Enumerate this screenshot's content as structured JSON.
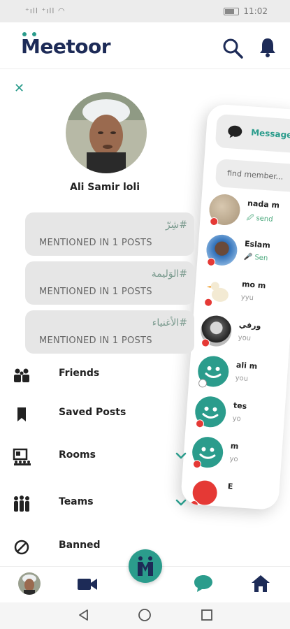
{
  "statusbar": {
    "signal": "⁺ıll ⁺ıll ◠",
    "time": "11:02"
  },
  "app": {
    "logo_text": "eetoor",
    "logo_m": "M"
  },
  "drawer": {
    "close_icon": "close-icon",
    "profile_name": "Ali Samir loli",
    "tags": [
      {
        "name": "#شِرّ",
        "count": "MENTIONED IN 1 POSTS"
      },
      {
        "name": "#الوَليمة",
        "count": "MENTIONED IN 1 POSTS"
      },
      {
        "name": "#الأغنياء",
        "count": "MENTIONED IN 1 POSTS"
      }
    ],
    "menu": [
      {
        "label": "Friends",
        "icon": "friends-icon"
      },
      {
        "label": "Saved Posts",
        "icon": "bookmark-icon"
      },
      {
        "label": "Rooms",
        "icon": "rooms-icon"
      },
      {
        "label": "Teams",
        "icon": "teams-icon"
      },
      {
        "label": "Banned",
        "icon": "banned-icon"
      }
    ]
  },
  "messages_panel": {
    "tab_label": "Messages",
    "search_placeholder": "find member...",
    "chats": [
      {
        "name": "nada m",
        "preview": "🖉 send"
      },
      {
        "name": "Eslam",
        "preview": "🎤 Sen"
      },
      {
        "name": "mo m",
        "preview": "yyu"
      },
      {
        "name": "ورقي",
        "preview": "you"
      },
      {
        "name": "ali m",
        "preview": "you"
      },
      {
        "name": "tes",
        "preview": "yo"
      },
      {
        "name": "m",
        "preview": "yo"
      },
      {
        "name": "E",
        "preview": ""
      }
    ]
  },
  "colors": {
    "accent": "#2b9c8c",
    "navy": "#1d2b57",
    "card": "#e6e6e6",
    "offline": "#e53935"
  }
}
